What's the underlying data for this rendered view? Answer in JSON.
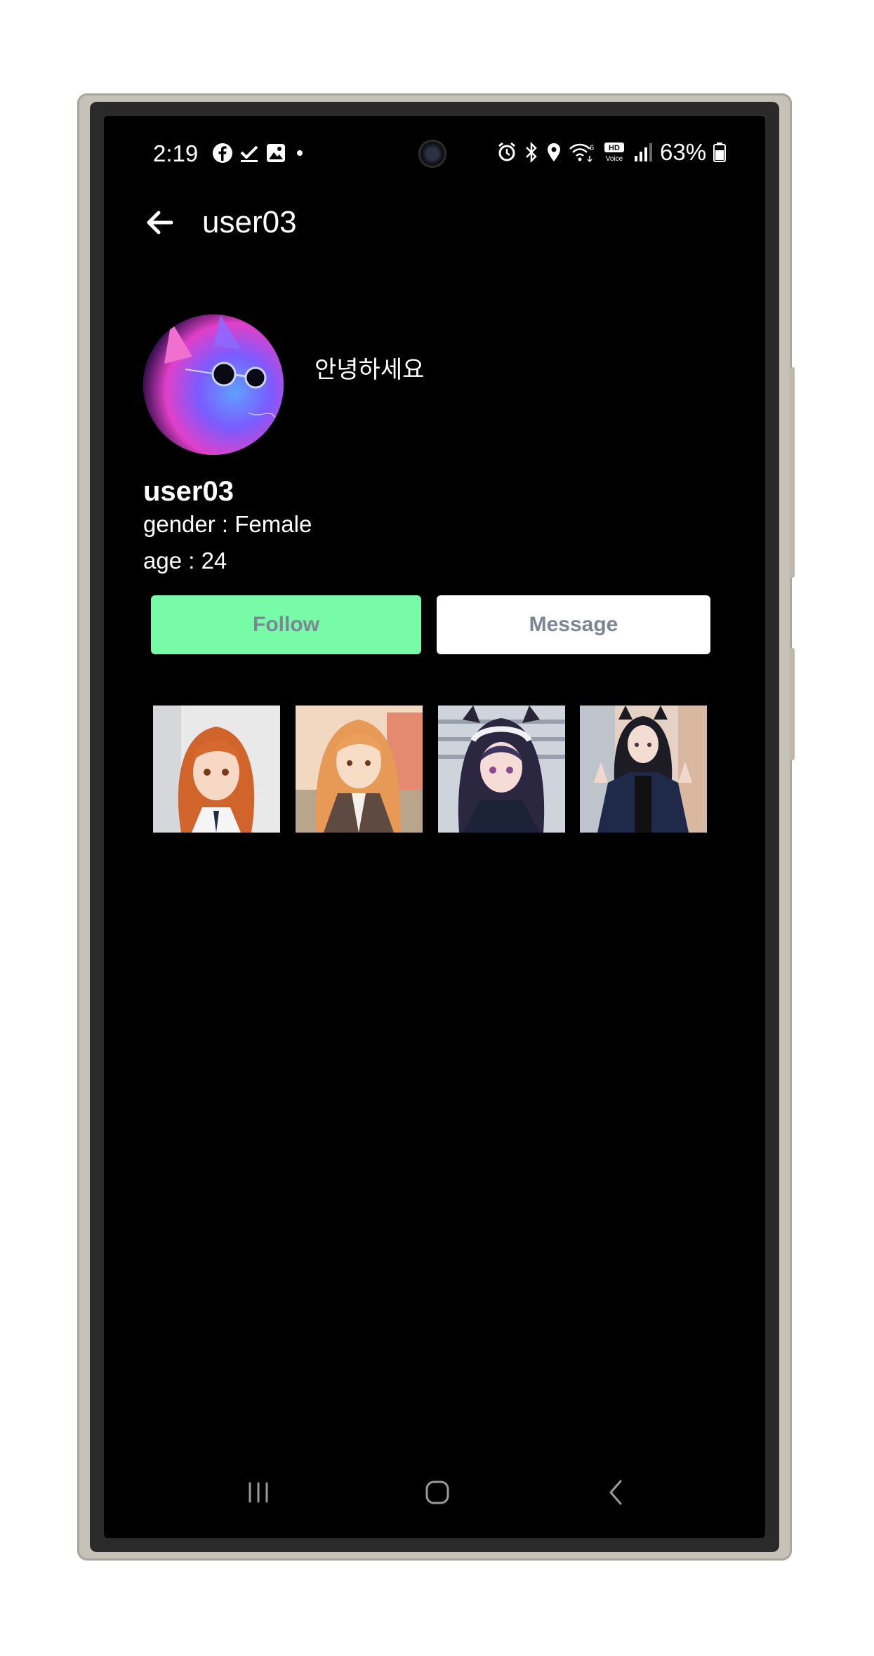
{
  "status_bar": {
    "time": "2:19",
    "battery": "63%",
    "icons": [
      "facebook-icon",
      "checkmark-icon",
      "gallery-icon",
      "dot-icon",
      "alarm-icon",
      "bluetooth-icon",
      "location-icon",
      "wifi-6-icon",
      "hd-voice-icon",
      "signal-icon",
      "battery-icon"
    ],
    "hd_text": "HD",
    "voice_text": "Voice",
    "wifi_badge": "6"
  },
  "app_bar": {
    "back_icon": "arrow-left-icon",
    "title": "user03"
  },
  "profile": {
    "bio": "안녕하세요",
    "username": "user03",
    "gender": "gender : Female",
    "age": "age : 24"
  },
  "actions": {
    "follow_label": "Follow",
    "message_label": "Message"
  },
  "colors": {
    "follow_bg": "#77fba6",
    "message_bg": "#ffffff",
    "button_text": "#7b8794",
    "screen_bg": "#000000"
  },
  "nav_bar": {
    "icons": [
      "recent-apps-icon",
      "home-icon",
      "back-icon"
    ]
  }
}
